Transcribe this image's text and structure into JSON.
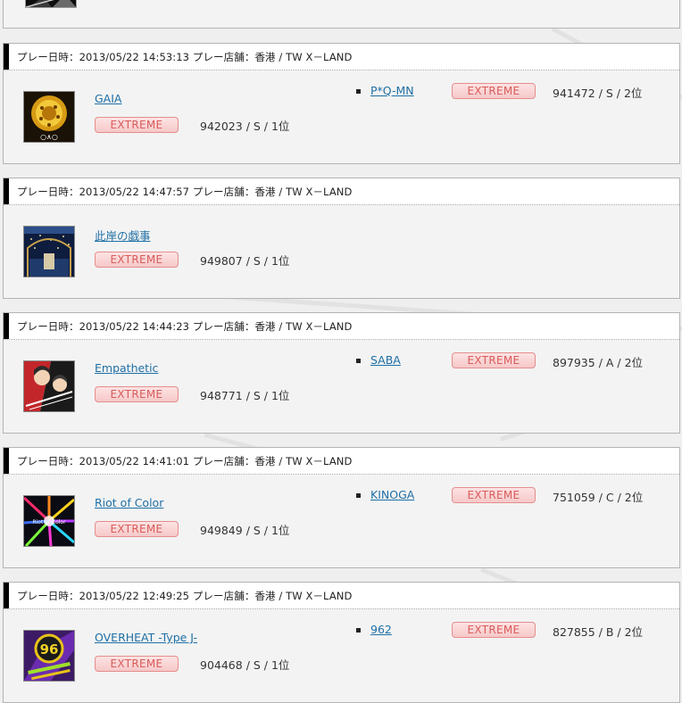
{
  "colors": {
    "accent_link": "#1f6fa5",
    "difficulty_badge": "#d95b5b",
    "header_bar": "#000000"
  },
  "records": [
    {
      "header": "プレー日時：2013/05/22 14:53:13 プレー店舗：香港 / TW  X－LAND",
      "song": "GAIA",
      "jacket_icon": "gaia-jacket",
      "difficulty": "EXTREME",
      "score": "942023 / S / 1位",
      "opponent": {
        "name": "P*Q-MN",
        "difficulty": "EXTREME",
        "score": "941472 / S / 2位"
      }
    },
    {
      "header": "プレー日時：2013/05/22 14:47:57 プレー店舗：香港 / TW  X－LAND",
      "song": "此岸の戯事",
      "jacket_icon": "shigan-jacket",
      "difficulty": "EXTREME",
      "score": "949807 / S / 1位"
    },
    {
      "header": "プレー日時：2013/05/22 14:44:23 プレー店舗：香港 / TW  X－LAND",
      "song": "Empathetic",
      "jacket_icon": "empathetic-jacket",
      "difficulty": "EXTREME",
      "score": "948771 / S / 1位",
      "opponent": {
        "name": "SABA",
        "difficulty": "EXTREME",
        "score": "897935 / A / 2位"
      }
    },
    {
      "header": "プレー日時：2013/05/22 14:41:01 プレー店舗：香港 / TW  X－LAND",
      "song": "Riot of Color",
      "jacket_icon": "riot-of-color-jacket",
      "jacket_text": "Riot of Color",
      "difficulty": "EXTREME",
      "score": "949849 / S / 1位",
      "opponent": {
        "name": "KINOGA",
        "difficulty": "EXTREME",
        "score": "751059 / C / 2位"
      }
    },
    {
      "header": "プレー日時：2013/05/22 12:49:25 プレー店舗：香港 / TW  X－LAND",
      "song": "OVERHEAT -Type J-",
      "jacket_icon": "overheat-jacket",
      "jacket_text": "96",
      "difficulty": "EXTREME",
      "score": "904468 / S / 1位",
      "opponent": {
        "name": "962",
        "difficulty": "EXTREME",
        "score": "827855 / B / 2位"
      }
    }
  ]
}
